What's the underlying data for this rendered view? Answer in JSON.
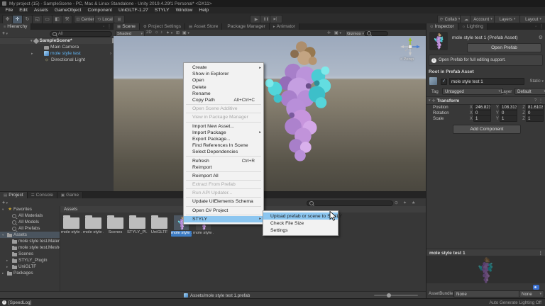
{
  "colors": {
    "selection_blue": "#3d7cc4",
    "prefab_text": "#5fb2f0",
    "menu_highlight": "#8cc6f0",
    "accent_gray": "#4a545e"
  },
  "window": {
    "title": "My project (15) - SampleScene - PC, Mac & Linux Standalone - Unity 2019.4.29f1 Personal* <DX11>"
  },
  "menu_bar": [
    "File",
    "Edit",
    "Assets",
    "GameObject",
    "Component",
    "UniGLTF-1.27",
    "STYLY",
    "Window",
    "Help"
  ],
  "icons": {
    "hand": "✥",
    "move": "✛",
    "rotate": "↻",
    "scale": "◱",
    "rect": "▭",
    "multi": "◧",
    "custom": "⚒",
    "pivot": "⊡",
    "space": "⟲",
    "snap": "⊞",
    "play": "▶",
    "pause": "❚❚",
    "step": "▶▏",
    "cloud": "☁",
    "collab": "⟳",
    "caret": "▾",
    "light": "☼",
    "audio": "♪",
    "fx": "✦",
    "grid": "⊞",
    "cam": "▣",
    "tools": "✛",
    "gear": "⚙",
    "dots": "⋮",
    "help": "?",
    "plus": "+",
    "arrow_right": "▸",
    "nav": "›",
    "check": "✓",
    "info": "!"
  },
  "toolbar": {
    "pivot": "Center",
    "space": "Local",
    "collab": "Collab",
    "account": "Account",
    "layers": "Layers",
    "layout": "Layout"
  },
  "hierarchy": {
    "tab": "Hierarchy",
    "search_value": "All",
    "scene_row": {
      "label": "SampleScene*"
    },
    "items": [
      {
        "label": "Main Camera",
        "icon": "camera"
      },
      {
        "label": "mole style test",
        "icon": "prefab",
        "prefab": true,
        "expand": true,
        "nav": true
      },
      {
        "label": "Directional Light",
        "icon": "light"
      }
    ]
  },
  "scene": {
    "tabs": [
      {
        "label": "Scene",
        "icon": "▦",
        "active": true
      },
      {
        "label": "Project Settings",
        "icon": "⚙"
      },
      {
        "label": "Asset Store",
        "icon": "▤"
      },
      {
        "label": "Package Manager",
        "icon": ""
      },
      {
        "label": "Animator",
        "icon": "▸"
      }
    ],
    "shading_mode": "Shaded",
    "toggle_2d": "2D",
    "gizmos_label": "Gizmos",
    "view_label": "< Persp"
  },
  "context_menu": {
    "items": [
      {
        "label": "Create",
        "arrow": true
      },
      {
        "label": "Show in Explorer"
      },
      {
        "label": "Open"
      },
      {
        "label": "Delete"
      },
      {
        "label": "Rename"
      },
      {
        "label": "Copy Path",
        "shortcut": "Alt+Ctrl+C"
      },
      {
        "sep": true
      },
      {
        "label": "Open Scene Additive",
        "disabled": true
      },
      {
        "sep": true
      },
      {
        "label": "View in Package Manager",
        "disabled": true
      },
      {
        "sep": true
      },
      {
        "label": "Import New Asset..."
      },
      {
        "label": "Import Package",
        "arrow": true
      },
      {
        "label": "Export Package..."
      },
      {
        "label": "Find References In Scene"
      },
      {
        "label": "Select Dependencies"
      },
      {
        "sep": true
      },
      {
        "label": "Refresh",
        "shortcut": "Ctrl+R"
      },
      {
        "label": "Reimport"
      },
      {
        "sep": true
      },
      {
        "label": "Reimport All"
      },
      {
        "sep": true
      },
      {
        "label": "Extract From Prefab",
        "disabled": true
      },
      {
        "sep": true
      },
      {
        "label": "Run API Updater...",
        "disabled": true
      },
      {
        "sep": true
      },
      {
        "label": "Update UIElements Schema"
      },
      {
        "sep": true
      },
      {
        "label": "Open C# Project"
      },
      {
        "sep": true
      },
      {
        "label": "STYLY",
        "arrow": true,
        "highlight": true
      }
    ],
    "submenu": [
      {
        "label": "Upload prefab or scene to STYLY",
        "highlight": true
      },
      {
        "label": "Check File Size"
      },
      {
        "label": "Settings"
      }
    ]
  },
  "inspector": {
    "tabs": [
      {
        "label": "Inspector",
        "icon": "⊙",
        "active": true
      },
      {
        "label": "Lighting",
        "icon": "☼"
      }
    ],
    "header_title": "mole style test 1 (Prefab Asset)",
    "open_prefab_button": "Open Prefab",
    "info_text": "Open Prefab for full editing support.",
    "section_title": "Root in Prefab Asset",
    "object_name": "mole style test 1",
    "static_label": "Static",
    "tag_label": "Tag",
    "tag_value": "Untagged",
    "layer_label": "Layer",
    "layer_value": "Default",
    "component_title": "Transform",
    "transform_rows": [
      {
        "label": "Position",
        "xl": "X",
        "x": "246.8234",
        "yl": "Y",
        "y": "108.3131",
        "zl": "Z",
        "z": "81.61032"
      },
      {
        "label": "Rotation",
        "xl": "X",
        "x": "0",
        "yl": "Y",
        "y": "0",
        "zl": "Z",
        "z": "0"
      },
      {
        "label": "Scale",
        "xl": "X",
        "x": "1",
        "yl": "Y",
        "y": "1",
        "zl": "Z",
        "z": "1"
      }
    ],
    "add_component_button": "Add Component",
    "preview_title": "mole style test 1",
    "assetbundle_label": "AssetBundle",
    "assetbundle_value": "None",
    "assetbundle_variant": "None"
  },
  "project": {
    "tabs": [
      {
        "label": "Project",
        "icon": "▤",
        "active": true
      },
      {
        "label": "Console",
        "icon": "☰"
      },
      {
        "label": "Game",
        "icon": "▣"
      }
    ],
    "tree": [
      {
        "label": "Favorites",
        "icon": "star",
        "arrow": "down",
        "depth": "0"
      },
      {
        "label": "All Materials",
        "icon": "search",
        "depth": "1"
      },
      {
        "label": "All Models",
        "icon": "search",
        "depth": "1"
      },
      {
        "label": "All Prefabs",
        "icon": "search",
        "depth": "1"
      },
      {
        "label": "Assets",
        "icon": "folder",
        "arrow": "down",
        "depth": "0",
        "selected": true
      },
      {
        "label": "mole style test.Materials",
        "icon": "folder",
        "depth": "1"
      },
      {
        "label": "mole style test.Meshes",
        "icon": "folder",
        "depth": "1"
      },
      {
        "label": "Scenes",
        "icon": "folder",
        "depth": "1"
      },
      {
        "label": "STYLY_Plugin",
        "icon": "folder",
        "arrow": "right",
        "depth": "1"
      },
      {
        "label": "UniGLTF",
        "icon": "folder",
        "arrow": "right",
        "depth": "1"
      },
      {
        "label": "Packages",
        "icon": "folder",
        "arrow": "right",
        "depth": "0"
      }
    ],
    "grid_header": "Assets",
    "grid_items": [
      {
        "label": "mole style ...",
        "is_folder": true
      },
      {
        "label": "mole style ...",
        "is_folder": true
      },
      {
        "label": "Scenes",
        "is_folder": true
      },
      {
        "label": "STYLY_Pl...",
        "is_folder": true
      },
      {
        "label": "UniGLTF",
        "is_folder": true
      },
      {
        "label": "mole style ...",
        "is_prefab": true,
        "selected": true
      },
      {
        "label": "mole style ...",
        "is_prefab": true
      }
    ],
    "selected_path": "Assets/mole style test 1.prefab"
  },
  "status_bar": {
    "left": "[SpeedLog]",
    "right": "Auto Generate Lighting Off"
  }
}
